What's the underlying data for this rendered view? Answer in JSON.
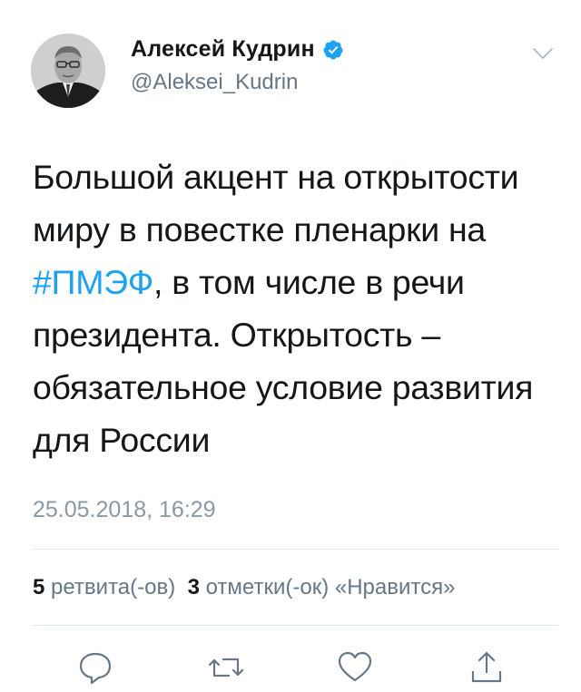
{
  "user": {
    "display_name": "Алексей Кудрин",
    "handle": "@Aleksei_Kudrin",
    "verified": true,
    "avatar_icon": "profile-photo"
  },
  "tweet": {
    "text_before": "Большой акцент на открытости миру в повестке пленарки на ",
    "hashtag": "#ПМЭФ",
    "text_after": ", в том числе в речи президента. Открытость – обязательное условие развития для России",
    "timestamp": "25.05.2018, 16:29"
  },
  "stats": {
    "retweets_count": "5",
    "retweets_label": "ретвита(-ов)",
    "likes_count": "3",
    "likes_label": "отметки(-ок) «Нравится»"
  },
  "actions": [
    "reply-icon",
    "retweet-icon",
    "like-icon",
    "share-icon"
  ],
  "colors": {
    "accent": "#1da1f2",
    "secondary_text": "#657786",
    "timestamp_text": "#8899a6",
    "divider": "#e1e8ed",
    "icon": "#657786"
  }
}
